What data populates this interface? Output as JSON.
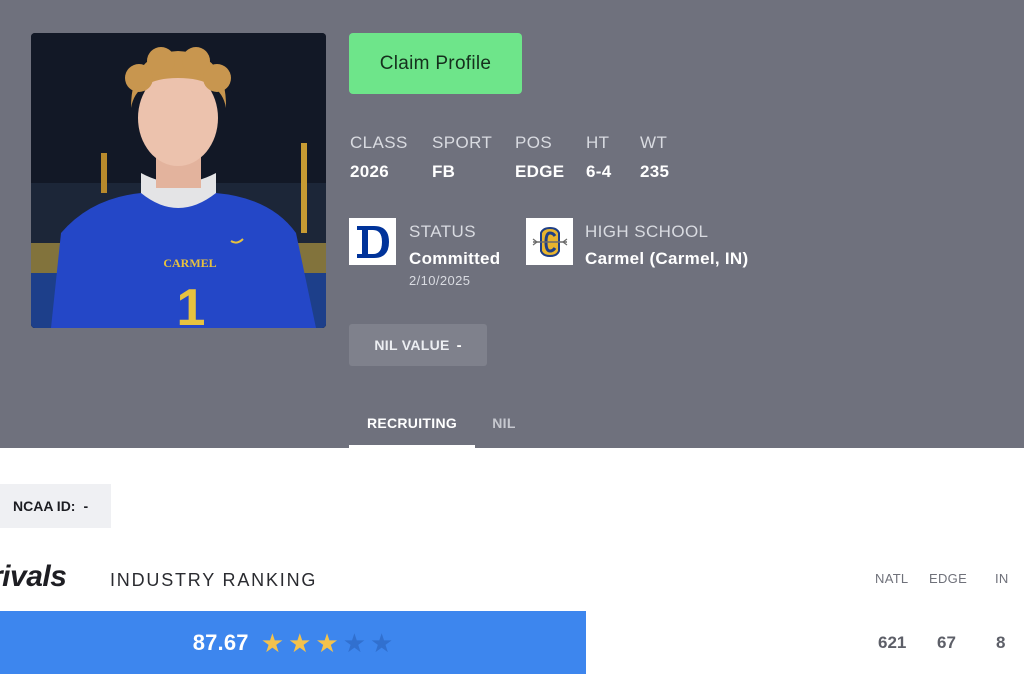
{
  "profile": {
    "claim_label": "Claim Profile",
    "stats": [
      {
        "label": "CLASS",
        "value": "2026"
      },
      {
        "label": "SPORT",
        "value": "FB"
      },
      {
        "label": "POS",
        "value": "EDGE"
      },
      {
        "label": "HT",
        "value": "6-4"
      },
      {
        "label": "WT",
        "value": "235"
      }
    ],
    "status": {
      "label": "STATUS",
      "value": "Committed",
      "date": "2/10/2025",
      "logo_icon": "duke-logo-icon"
    },
    "high_school": {
      "label": "HIGH SCHOOL",
      "value": "Carmel (Carmel, IN)",
      "logo_icon": "carmel-logo-icon"
    },
    "nil": {
      "label": "NIL VALUE",
      "value": "-"
    },
    "photo": {
      "jersey_text": "CARMEL",
      "jersey_number": "1"
    }
  },
  "tabs": [
    {
      "label": "RECRUITING",
      "active": true
    },
    {
      "label": "NIL",
      "active": false
    }
  ],
  "ncaa": {
    "label": "NCAA ID:",
    "value": "-"
  },
  "ranking": {
    "brand": "rivals",
    "title": "INDUSTRY RANKING",
    "score": "87.67",
    "stars_filled": 3,
    "stars_total": 5,
    "columns": [
      {
        "label": "NATL",
        "value": "621"
      },
      {
        "label": "EDGE",
        "value": "67"
      },
      {
        "label": "IN",
        "value": "8"
      }
    ]
  },
  "colors": {
    "hero_bg": "#6f717d",
    "claim_button": "#6ee58a",
    "rating_bar": "#3d86ee",
    "star_on": "#f3c24c",
    "duke_blue": "#00339a"
  }
}
